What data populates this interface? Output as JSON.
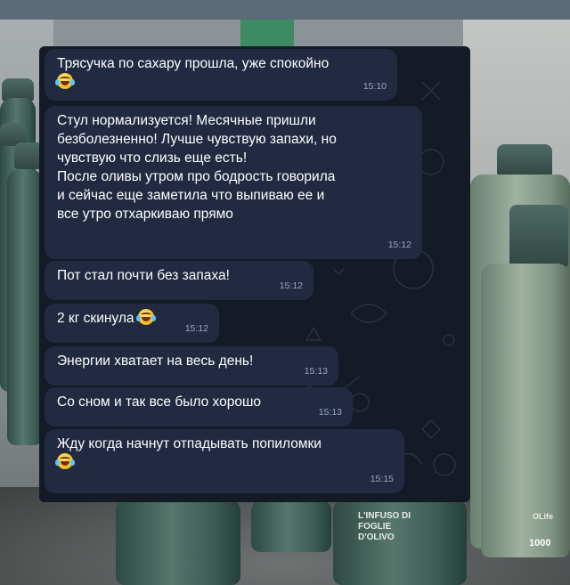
{
  "chat": {
    "messages": [
      {
        "text": "Трясучка по сахару прошла, уже спокойно",
        "time": "15:10",
        "emoji": "joy-emoji"
      },
      {
        "text": "Стул нормализуется! Месячные пришли\nбезболезненно! Лучше чувствую запахи, но\nчувствую что слизь еще есть!\nПосле оливы утром про бодрость говорила\nи сейчас еще заметила что выпиваю ее и\nвсе утро отхаркиваю прямо",
        "time": "15:12"
      },
      {
        "text": "Пот стал почти без запаха!",
        "time": "15:12"
      },
      {
        "text": "2 кг скинула",
        "time": "15:12",
        "emoji": "joy-emoji"
      },
      {
        "text": "Энергии хватает на весь день!",
        "time": "15:13"
      },
      {
        "text": "Со сном и так все было хорошо",
        "time": "15:13"
      },
      {
        "text": "Жду когда начнут отпадывать попиломки",
        "time": "15:15",
        "emoji": "joy-emoji"
      }
    ]
  },
  "background": {
    "bottle_labels": [
      "L'INFUSO DI FOGLIE D'OLIVO",
      "1000",
      "OLife"
    ]
  },
  "colors": {
    "chat_background": "#141a26",
    "bubble": "#212a40",
    "text": "#ffffff",
    "time": "#9aa6c2"
  }
}
